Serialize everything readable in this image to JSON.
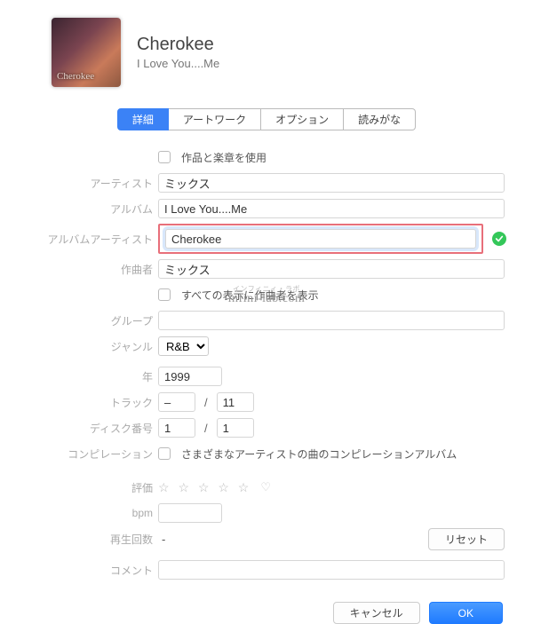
{
  "header": {
    "title": "Cherokee",
    "subtitle": "I Love You....Me",
    "artwork_text": "Cherokee"
  },
  "tabs": {
    "items": [
      {
        "label": "詳細",
        "active": true
      },
      {
        "label": "アートワーク",
        "active": false
      },
      {
        "label": "オプション",
        "active": false
      },
      {
        "label": "読みがな",
        "active": false
      }
    ]
  },
  "fields": {
    "use_work_movement_label": "作品と楽章を使用",
    "artist_label": "アーティスト",
    "artist_value": "ミックス",
    "album_label": "アルバム",
    "album_value": "I Love You....Me",
    "album_artist_label": "アルバムアーティスト",
    "album_artist_value": "Cherokee",
    "composer_label": "作曲者",
    "composer_value": "ミックス",
    "show_composer_label": "すべての表示に作曲者を表示",
    "group_label": "グループ",
    "group_value": "",
    "genre_label": "ジャンル",
    "genre_value": "R&B",
    "year_label": "年",
    "year_value": "1999",
    "track_label": "トラック",
    "track_value": "–",
    "track_total": "11",
    "disc_label": "ディスク番号",
    "disc_value": "1",
    "disc_total": "1",
    "compilation_label": "コンピレーション",
    "compilation_text": "さまざまなアーティストの曲のコンピレーションアルバム",
    "rating_label": "評価",
    "bpm_label": "bpm",
    "bpm_value": "",
    "plays_label": "再生回数",
    "plays_value": "-",
    "reset_button": "リセット",
    "comment_label": "コメント",
    "comment_value": ""
  },
  "footer": {
    "cancel": "キャンセル",
    "ok": "OK"
  },
  "watermark": "infini-lab.com",
  "watermark_tiny": "インフィニィ・ラボ"
}
